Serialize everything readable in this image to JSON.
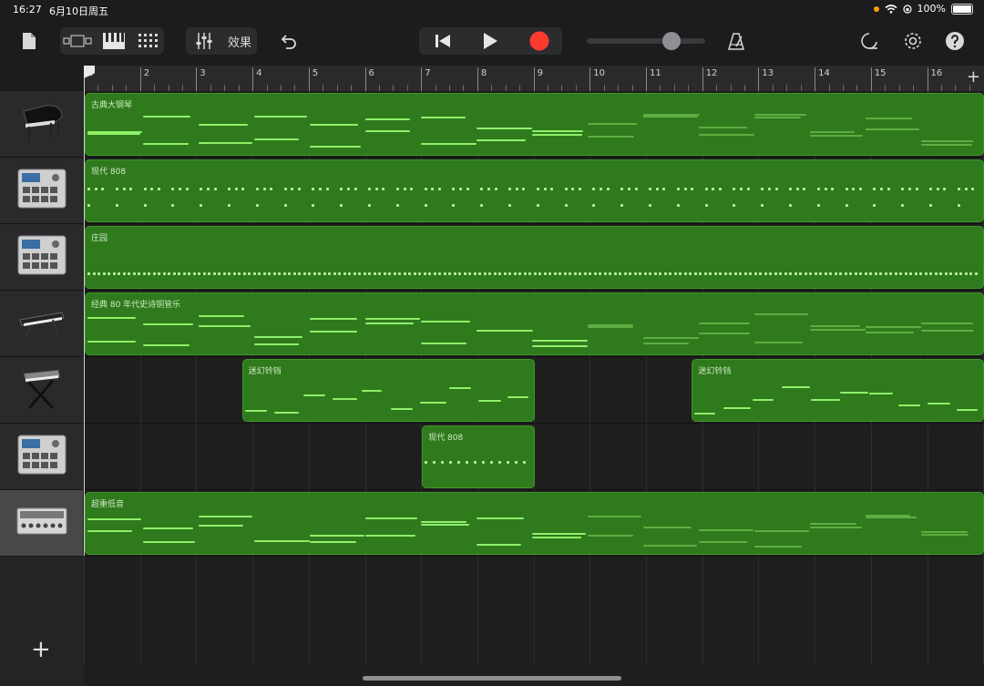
{
  "status": {
    "time": "16:27",
    "date": "6月10日周五",
    "battery": "100%"
  },
  "toolbar": {
    "effects_label": "效果"
  },
  "ruler": {
    "bars": [
      "1",
      "2",
      "3",
      "4",
      "5",
      "6",
      "7",
      "8",
      "9",
      "10",
      "11",
      "12",
      "13",
      "14",
      "15",
      "16"
    ],
    "add": "+"
  },
  "tracks": [
    {
      "name": "古典大钢琴",
      "icon": "grand-piano-icon"
    },
    {
      "name": "现代 808",
      "icon": "drum-machine-icon"
    },
    {
      "name": "庄园",
      "icon": "drum-machine-icon"
    },
    {
      "name": "经典 80 年代史诗铜管乐",
      "icon": "keyboard-synth-icon"
    },
    {
      "name": "迷幻铃铛",
      "icon": "keyboard-stand-icon"
    },
    {
      "name": "现代 808",
      "icon": "drum-machine-icon"
    },
    {
      "name": "超重低音",
      "icon": "synth-module-icon"
    }
  ],
  "regions": [
    {
      "track": 0,
      "label": "古典大钢琴",
      "start": 1,
      "end": 17,
      "style": "melody"
    },
    {
      "track": 1,
      "label": "现代 808",
      "start": 1,
      "end": 17,
      "style": "drums"
    },
    {
      "track": 2,
      "label": "庄园",
      "start": 1,
      "end": 17,
      "style": "drums-dense"
    },
    {
      "track": 3,
      "label": "经典 80 年代史诗铜管乐",
      "start": 1,
      "end": 17,
      "style": "melody"
    },
    {
      "track": 4,
      "label": "迷幻铃铛",
      "start": 3.8,
      "end": 9,
      "style": "sparse"
    },
    {
      "track": 4,
      "label": "迷幻铃铛",
      "start": 11.8,
      "end": 17,
      "style": "sparse"
    },
    {
      "track": 5,
      "label": "现代 808",
      "start": 7,
      "end": 9,
      "style": "drums-small"
    },
    {
      "track": 6,
      "label": "超重低音",
      "start": 1,
      "end": 17,
      "style": "melody"
    }
  ],
  "colors": {
    "region": "#2f7a1d",
    "note": "#8ff06a",
    "record": "#ff3b30"
  },
  "transport": {
    "volume_level": 0.75
  }
}
